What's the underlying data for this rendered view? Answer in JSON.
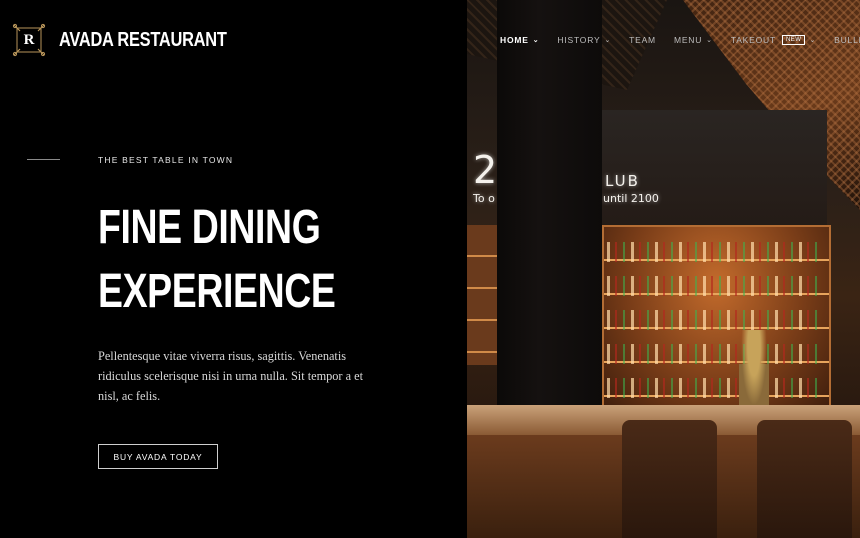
{
  "header": {
    "logo_letter": "R",
    "brand": "AVADA RESTAURANT"
  },
  "nav": {
    "items": [
      {
        "label": "HOME",
        "active": true,
        "has_dropdown": true
      },
      {
        "label": "HISTORY",
        "active": false,
        "has_dropdown": true
      },
      {
        "label": "TEAM",
        "active": false,
        "has_dropdown": false
      },
      {
        "label": "MENU",
        "active": false,
        "has_dropdown": true
      },
      {
        "label": "TAKEOUT",
        "active": false,
        "has_dropdown": true,
        "badge": "NEW"
      },
      {
        "label": "BULLE",
        "active": false,
        "has_dropdown": false
      }
    ]
  },
  "hero": {
    "tagline": "THE BEST TABLE IN TOWN",
    "headline_line1": "FINE DINING",
    "headline_line2": "EXPERIENCE",
    "paragraph": "Pellentesque vitae viverra risus, sagittis. Venenatis ridiculus scelerisque nisi in urna nulla. Sit tempor a et nisl, ac felis.",
    "cta_label": "BUY AVADA TODAY"
  },
  "photo": {
    "neon_left": "2",
    "neon_right": "LUB",
    "neon_small_left": "To o",
    "neon_small_right": "until 2100"
  },
  "colors": {
    "background": "#000000",
    "text": "#ffffff",
    "muted_text": "#bdbdbd",
    "accent_warm": "#c36b2c"
  }
}
